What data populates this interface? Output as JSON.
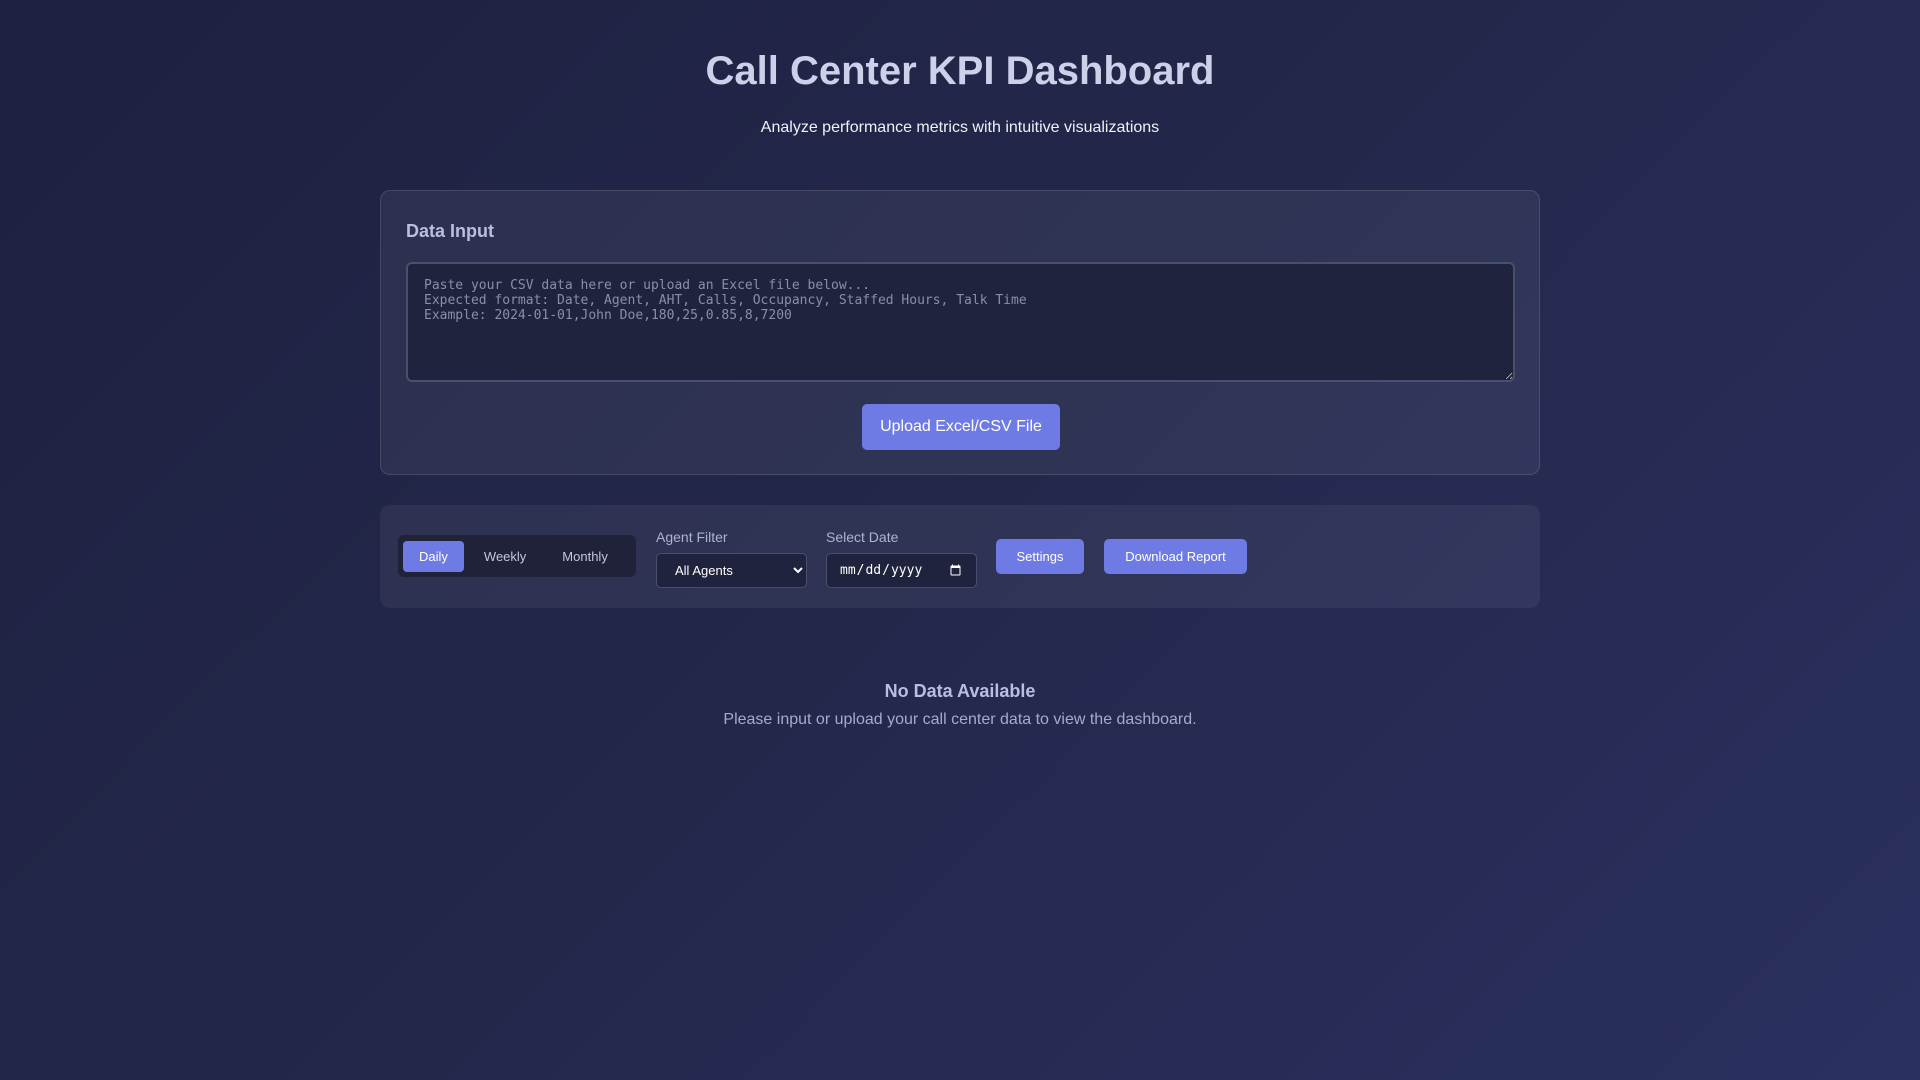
{
  "header": {
    "title": "Call Center KPI Dashboard",
    "subtitle": "Analyze performance metrics with intuitive visualizations"
  },
  "data_input": {
    "title": "Data Input",
    "textarea_placeholder": "Paste your CSV data here or upload an Excel file below...\nExpected format: Date, Agent, AHT, Calls, Occupancy, Staffed Hours, Talk Time\nExample: 2024-01-01,John Doe,180,25,0.85,8,7200",
    "textarea_value": "",
    "upload_label": "Upload Excel/CSV File"
  },
  "controls": {
    "periods": [
      {
        "label": "Daily",
        "active": true
      },
      {
        "label": "Weekly",
        "active": false
      },
      {
        "label": "Monthly",
        "active": false
      }
    ],
    "agent_filter": {
      "label": "Agent Filter",
      "selected": "All Agents"
    },
    "date_picker": {
      "label": "Select Date",
      "value": ""
    },
    "settings_label": "Settings",
    "download_label": "Download Report"
  },
  "empty_state": {
    "title": "No Data Available",
    "message": "Please input or upload your call center data to view the dashboard."
  },
  "colors": {
    "accent": "#6f7be4",
    "background": "#23284b",
    "panel_field": "#20233d"
  }
}
